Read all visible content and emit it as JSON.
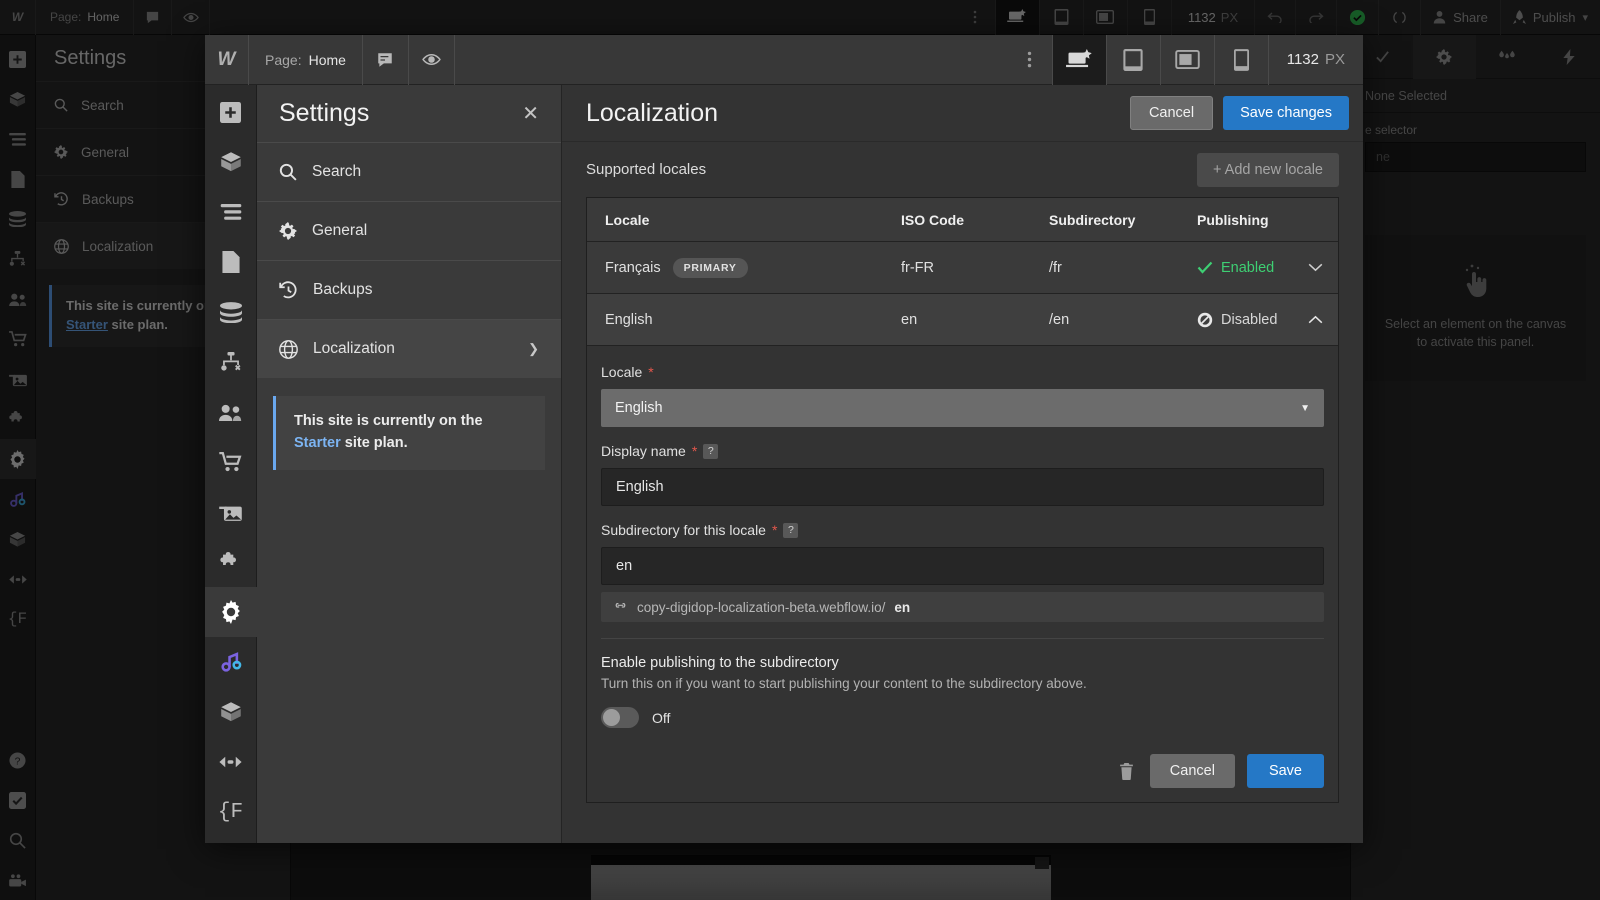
{
  "topbar": {
    "logo": "W",
    "page_label": "Page:",
    "page_value": "Home",
    "breakpoints": [
      "desktop-starred",
      "tablet",
      "landscape",
      "mobile"
    ],
    "viewport_number": "1132",
    "viewport_unit": "PX",
    "share_label": "Share",
    "publish_label": "Publish"
  },
  "modal_topbar": {
    "logo": "W",
    "page_label": "Page:",
    "page_value": "Home",
    "viewport_number": "1132",
    "viewport_unit": "PX"
  },
  "settings": {
    "title": "Settings",
    "close": "✕",
    "items": [
      {
        "label": "Search",
        "icon": "search-icon"
      },
      {
        "label": "General",
        "icon": "gear-icon"
      },
      {
        "label": "Backups",
        "icon": "history-icon"
      },
      {
        "label": "Localization",
        "icon": "globe-icon"
      }
    ],
    "note": {
      "line1": "This site is currently on the",
      "link": "Starter",
      "line2": " site plan."
    }
  },
  "main": {
    "title": "Localization",
    "cancel_label": "Cancel",
    "save_changes_label": "Save changes",
    "supported_locales_label": "Supported locales",
    "add_locale_label": "+ Add new locale",
    "table": {
      "headers": [
        "Locale",
        "ISO Code",
        "Subdirectory",
        "Publishing"
      ],
      "rows": [
        {
          "locale": "Français",
          "badge": "PRIMARY",
          "iso": "fr-FR",
          "subdirectory": "/fr",
          "publishing": "Enabled",
          "publishing_state": "enabled",
          "expanded": false,
          "chevron": "down"
        },
        {
          "locale": "English",
          "badge": "",
          "iso": "en",
          "subdirectory": "/en",
          "publishing": "Disabled",
          "publishing_state": "disabled",
          "expanded": true,
          "chevron": "up"
        }
      ]
    },
    "form": {
      "locale_label": "Locale",
      "locale_value": "English",
      "display_name_label": "Display name",
      "display_name_value": "English",
      "subdirectory_label": "Subdirectory for this locale",
      "subdirectory_value": "en",
      "url_base": "copy-digidop-localization-beta.webflow.io/",
      "url_suffix": "en",
      "publishing_heading": "Enable publishing to the subdirectory",
      "publishing_description": "Turn this on if you want to start publishing your content to the subdirectory above.",
      "toggle_state": "Off",
      "cancel_label": "Cancel",
      "save_label": "Save",
      "required_mark": "*",
      "help_mark": "?"
    }
  },
  "background_right_panel": {
    "selection": "None Selected",
    "selector_label": "e selector",
    "selector_placeholder": "ne",
    "empty_line1": "Select an element on the canvas",
    "empty_line2": "to activate this panel."
  },
  "colors": {
    "accent_blue": "#2578c6",
    "enabled_green": "#3ecf73",
    "required_red": "#e4574c",
    "link_blue": "#6aa8ef"
  }
}
